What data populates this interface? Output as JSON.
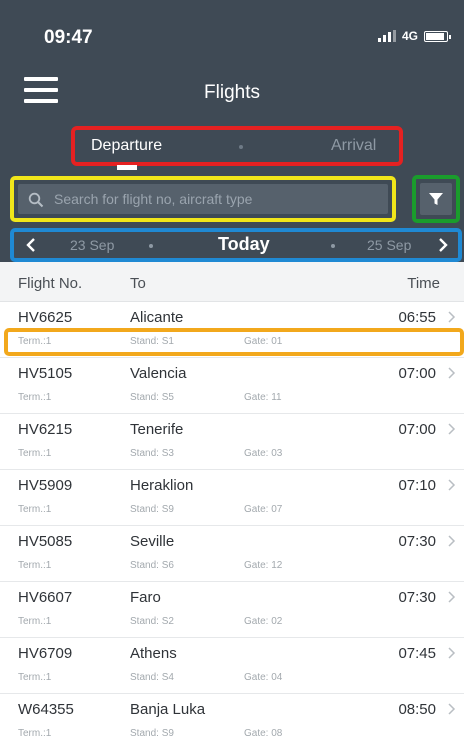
{
  "status_bar": {
    "time": "09:47",
    "network": "4G",
    "icons": [
      "signal-icon",
      "battery-icon"
    ]
  },
  "app_bar": {
    "title": "Flights",
    "menu_icon": "hamburger-menu-icon"
  },
  "segment": {
    "departure_label": "Departure",
    "arrival_label": "Arrival",
    "selected": "Departure"
  },
  "search": {
    "placeholder": "Search for flight no, aircraft type",
    "value": "",
    "icon": "search-icon",
    "filter_icon": "filter-funnel-icon"
  },
  "date_nav": {
    "prev": "23 Sep",
    "current": "Today",
    "next": "25 Sep"
  },
  "columns": {
    "flight_no": "Flight No.",
    "to": "To",
    "time": "Time"
  },
  "flights": [
    {
      "flight_no": "HV6625",
      "to": "Alicante",
      "time": "06:55",
      "term": "Term.:1",
      "stand": "Stand: S1",
      "gate": "Gate: 01"
    },
    {
      "flight_no": "HV5105",
      "to": "Valencia",
      "time": "07:00",
      "term": "Term.:1",
      "stand": "Stand: S5",
      "gate": "Gate: 11"
    },
    {
      "flight_no": "HV6215",
      "to": "Tenerife",
      "time": "07:00",
      "term": "Term.:1",
      "stand": "Stand: S3",
      "gate": "Gate: 03"
    },
    {
      "flight_no": "HV5909",
      "to": "Heraklion",
      "time": "07:10",
      "term": "Term.:1",
      "stand": "Stand: S9",
      "gate": "Gate: 07"
    },
    {
      "flight_no": "HV5085",
      "to": "Seville",
      "time": "07:30",
      "term": "Term.:1",
      "stand": "Stand: S6",
      "gate": "Gate: 12"
    },
    {
      "flight_no": "HV6607",
      "to": "Faro",
      "time": "07:30",
      "term": "Term.:1",
      "stand": "Stand: S2",
      "gate": "Gate: 02"
    },
    {
      "flight_no": "HV6709",
      "to": "Athens",
      "time": "07:45",
      "term": "Term.:1",
      "stand": "Stand: S4",
      "gate": "Gate: 04"
    },
    {
      "flight_no": "W64355",
      "to": "Banja Luka",
      "time": "08:50",
      "term": "Term.:1",
      "stand": "Stand: S9",
      "gate": "Gate: 08"
    }
  ],
  "colors": {
    "header_bg": "#3f4a55",
    "annotation_red": "#e52121",
    "annotation_yellow": "#f1e61a",
    "annotation_green": "#1a9c2c",
    "annotation_blue": "#1f89d3",
    "annotation_orange": "#f2a81c"
  }
}
